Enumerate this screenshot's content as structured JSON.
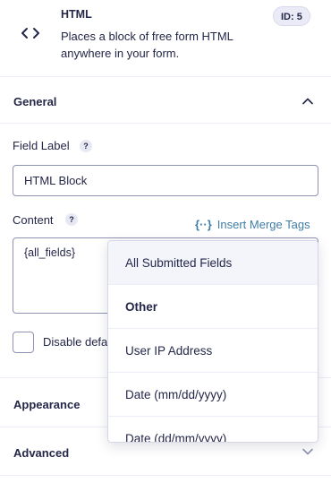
{
  "field": {
    "title": "HTML",
    "description": "Places a block of free form HTML anywhere in your form.",
    "id_badge": "ID: 5",
    "icon": "code-icon"
  },
  "sections": {
    "general": {
      "title": "General",
      "state": "expanded"
    },
    "appearance": {
      "title": "Appearance"
    },
    "advanced": {
      "title": "Advanced",
      "state": "collapsed"
    }
  },
  "field_label": {
    "label": "Field Label",
    "help": "?",
    "value": "HTML Block"
  },
  "content": {
    "label": "Content",
    "help": "?",
    "value": "{all_fields}",
    "insert_merge_tags_label": "Insert Merge Tags",
    "merge_icon": "{··}"
  },
  "disable_checkbox": {
    "label": "Disable defa",
    "checked": false
  },
  "merge_dropdown": {
    "items": [
      {
        "label": "All Submitted Fields",
        "kind": "option",
        "highlighted": true
      },
      {
        "label": "Other",
        "kind": "group"
      },
      {
        "label": "User IP Address",
        "kind": "option"
      },
      {
        "label": "Date (mm/dd/yyyy)",
        "kind": "option"
      },
      {
        "label": "Date (dd/mm/yyyy)",
        "kind": "option"
      }
    ]
  },
  "colors": {
    "text": "#242748",
    "link": "#3e7da6",
    "border": "#9092b2",
    "divider": "#ecedf8"
  }
}
